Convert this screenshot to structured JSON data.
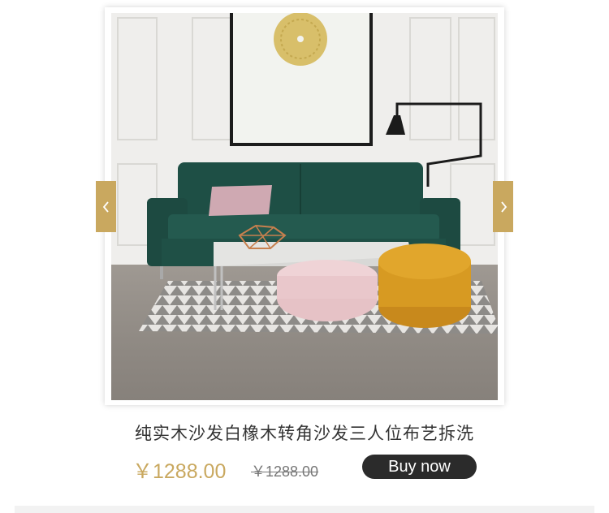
{
  "product": {
    "title": "纯实木沙发白橡木转角沙发三人位布艺拆洗",
    "price_current": "￥1288.00",
    "price_original": "￥1288.00",
    "buy_label": "Buy now"
  },
  "carousel": {
    "prev_icon": "chevron-left-icon",
    "next_icon": "chevron-right-icon"
  },
  "colors": {
    "accent": "#c9a85f",
    "button_bg": "#2b2b2b"
  }
}
